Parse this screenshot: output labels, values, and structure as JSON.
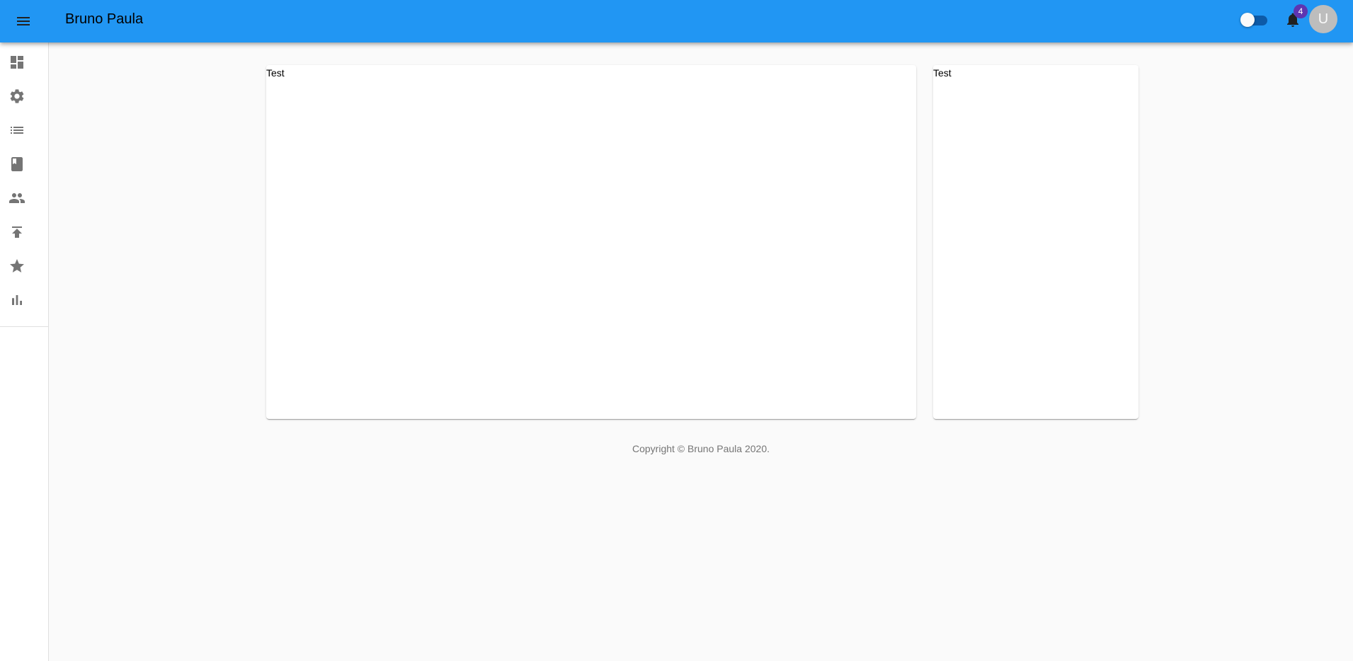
{
  "appbar": {
    "title": "Bruno Paula",
    "menu_icon": "menu-icon",
    "theme_toggle": {
      "on": false
    },
    "notifications": {
      "icon": "bell-icon",
      "count": "4"
    },
    "avatar": {
      "initial": "U"
    },
    "colors": {
      "primary": "#2196f3",
      "badge": "#5e35b1"
    }
  },
  "sidebar": {
    "items": [
      {
        "icon": "dashboard-icon"
      },
      {
        "icon": "gear-icon"
      },
      {
        "icon": "list-icon"
      },
      {
        "icon": "book-icon"
      },
      {
        "icon": "people-icon"
      },
      {
        "icon": "publish-icon"
      },
      {
        "icon": "star-icon"
      },
      {
        "icon": "bar-chart-icon"
      }
    ]
  },
  "main": {
    "cards": [
      {
        "text": "Test"
      },
      {
        "text": "Test"
      }
    ]
  },
  "footer": {
    "copyright": "Copyright © Bruno Paula 2020."
  }
}
